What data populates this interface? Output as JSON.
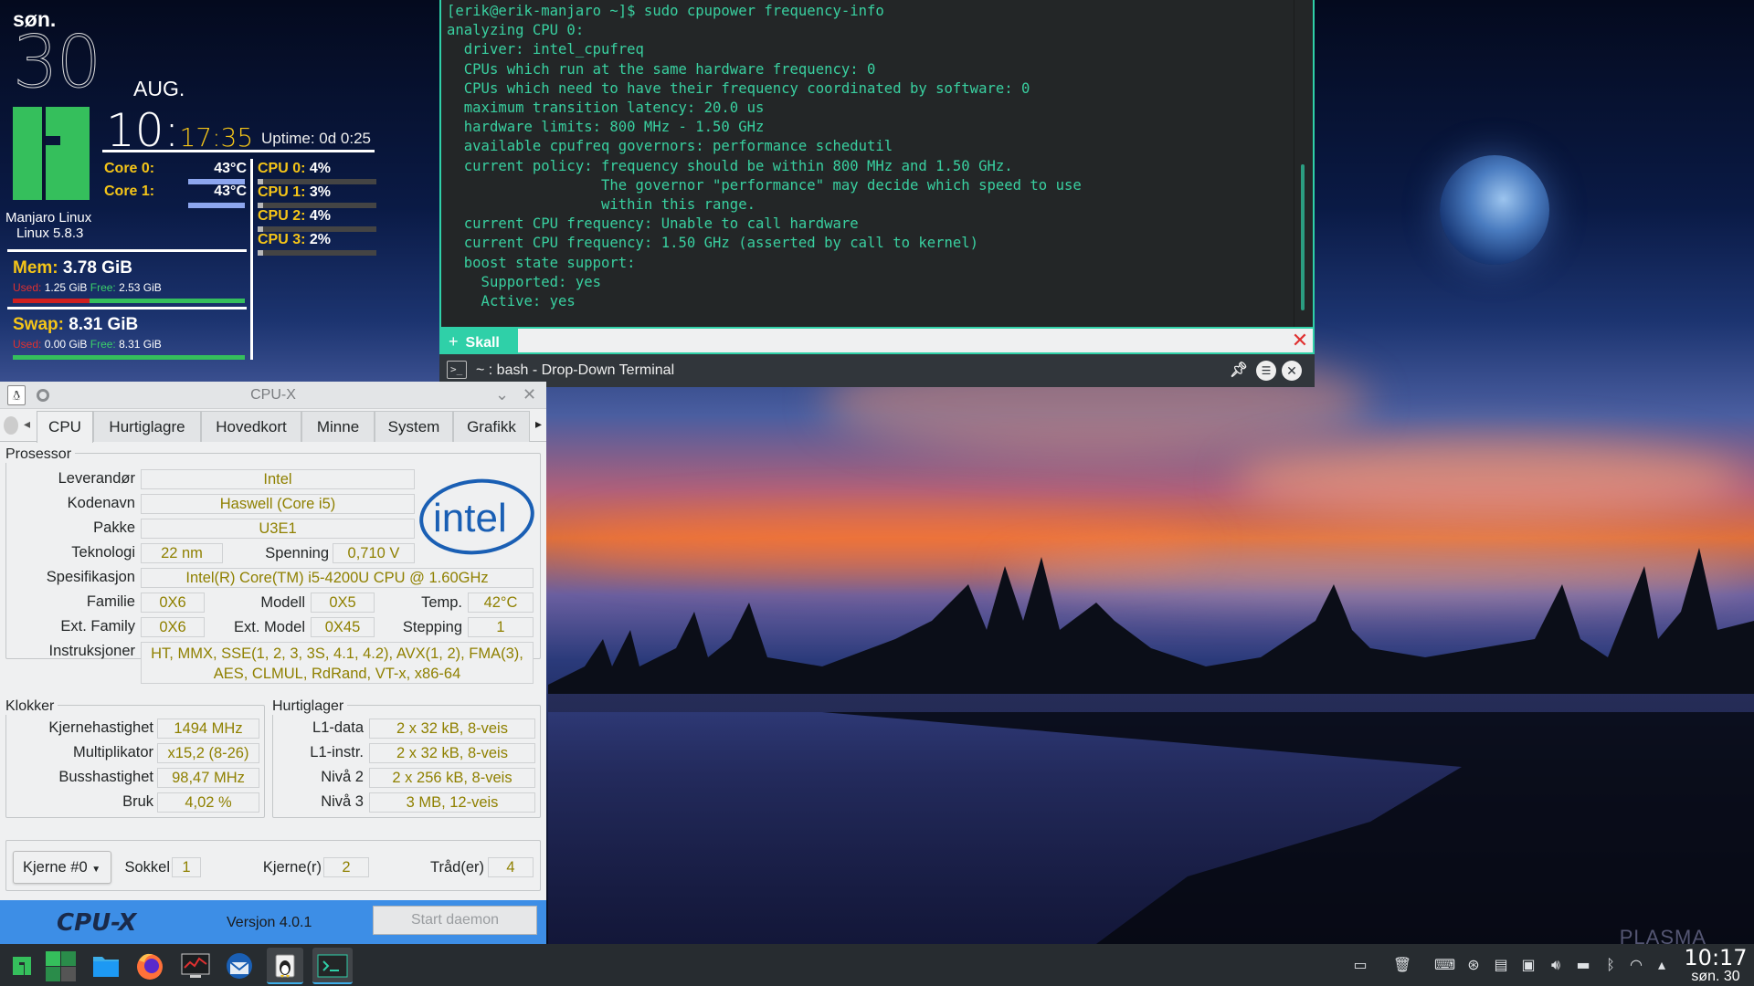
{
  "conky": {
    "day": "søn.",
    "date": "30",
    "month": "AUG.",
    "time_hm": "10:",
    "time_ms": "17:35",
    "uptime": "Uptime: 0d 0:25",
    "cores": [
      {
        "label": "Core 0:",
        "temp": "43°C"
      },
      {
        "label": "Core 1:",
        "temp": "43°C"
      }
    ],
    "cpus": [
      {
        "label": "CPU 0:",
        "pct": "4%",
        "level": 0.04
      },
      {
        "label": "CPU 1:",
        "pct": "3%",
        "level": 0.03
      },
      {
        "label": "CPU 2:",
        "pct": "4%",
        "level": 0.04
      },
      {
        "label": "CPU 3:",
        "pct": "2%",
        "level": 0.02
      }
    ],
    "os_name": "Manjaro Linux",
    "kernel": "Linux 5.8.3",
    "mem": {
      "label": "Mem:",
      "total": "3.78 GiB",
      "used_label": "Used:",
      "used": "1.25 GiB",
      "free_label": "Free:",
      "free": "2.53 GiB",
      "used_fraction": 0.33
    },
    "swap": {
      "label": "Swap:",
      "total": "8.31 GiB",
      "used_label": "Used:",
      "used": "0.00 GiB",
      "free_label": "Free:",
      "free": "8.31 GiB",
      "used_fraction": 0.0
    }
  },
  "terminal": {
    "lines": [
      "[erik@erik-manjaro ~]$ sudo cpupower frequency-info",
      "analyzing CPU 0:",
      "  driver: intel_cpufreq",
      "  CPUs which run at the same hardware frequency: 0",
      "  CPUs which need to have their frequency coordinated by software: 0",
      "  maximum transition latency: 20.0 us",
      "  hardware limits: 800 MHz - 1.50 GHz",
      "  available cpufreq governors: performance schedutil",
      "  current policy: frequency should be within 800 MHz and 1.50 GHz.",
      "                  The governor \"performance\" may decide which speed to use",
      "                  within this range.",
      "  current CPU frequency: Unable to call hardware",
      "  current CPU frequency: 1.50 GHz (asserted by call to kernel)",
      "  boost state support:",
      "    Supported: yes",
      "    Active: yes"
    ],
    "tab_label": "Skall",
    "title": "~ : bash - Drop-Down Terminal"
  },
  "cpux": {
    "window_title": "CPU-X",
    "tabs": [
      "CPU",
      "Hurtiglagre",
      "Hovedkort",
      "Minne",
      "System",
      "Grafikk"
    ],
    "active_tab": "CPU",
    "processor": {
      "group_label": "Prosessor",
      "vendor_label": "Leverandør",
      "vendor": "Intel",
      "codename_label": "Kodenavn",
      "codename": "Haswell (Core i5)",
      "package_label": "Pakke",
      "package": "U3E1",
      "tech_label": "Teknologi",
      "tech": "22 nm",
      "voltage_label": "Spenning",
      "voltage": "0,710 V",
      "spec_label": "Spesifikasjon",
      "spec": "Intel(R) Core(TM) i5-4200U CPU @ 1.60GHz",
      "family_label": "Familie",
      "family": "0X6",
      "model_label": "Modell",
      "model": "0X5",
      "temp_label": "Temp.",
      "temp": "42°C",
      "extfamily_label": "Ext. Family",
      "extfamily": "0X6",
      "extmodel_label": "Ext. Model",
      "extmodel": "0X45",
      "stepping_label": "Stepping",
      "stepping": "1",
      "instr_label": "Instruksjoner",
      "instr": "HT, MMX, SSE(1, 2, 3, 3S, 4.1, 4.2), AVX(1, 2), FMA(3), AES, CLMUL, RdRand, VT-x, x86-64",
      "logo_text": "intel"
    },
    "clocks": {
      "group_label": "Klokker",
      "core_speed_label": "Kjernehastighet",
      "core_speed": "1494 MHz",
      "multiplier_label": "Multiplikator",
      "multiplier": "x15,2 (8-26)",
      "bus_speed_label": "Busshastighet",
      "bus_speed": "98,47 MHz",
      "usage_label": "Bruk",
      "usage": "4,02 %"
    },
    "caches": {
      "group_label": "Hurtiglager",
      "l1d_label": "L1-data",
      "l1d": "2 x 32 kB, 8-veis",
      "l1i_label": "L1-instr.",
      "l1i": "2 x 32 kB, 8-veis",
      "l2_label": "Nivå 2",
      "l2": "2 x 256 kB, 8-veis",
      "l3_label": "Nivå 3",
      "l3": "3 MB, 12-veis"
    },
    "bottom": {
      "core_select": "Kjerne #0",
      "socket_label": "Sokkel",
      "socket": "1",
      "cores_label": "Kjerne(r)",
      "cores": "2",
      "threads_label": "Tråd(er)",
      "threads": "4"
    },
    "footer": {
      "brand": "CPU-X",
      "version": "Versjon 4.0.1",
      "daemon_button": "Start daemon"
    }
  },
  "wallpaper": {
    "watermark": "PLASMA"
  },
  "taskbar": {
    "apps": [
      "manjaro-menu-icon",
      "pager-icon",
      "file-manager-icon",
      "firefox-icon",
      "system-monitor-icon",
      "thunderbird-icon",
      "cpu-x-icon",
      "terminal-icon"
    ],
    "clock_time": "10:17",
    "clock_date": "søn. 30"
  },
  "colors": {
    "accent": "#2fd0a8",
    "terminal_text": "#39d0a0",
    "conky_yellow": "#f5c518",
    "manjaro_green": "#35bf5c",
    "cpux_value": "#8f8000",
    "cpux_footer": "#3d8ee6"
  }
}
